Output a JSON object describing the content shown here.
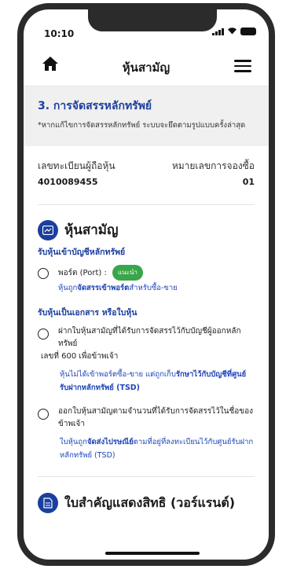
{
  "status": {
    "time": "10:10"
  },
  "header": {
    "title": "หุ้นสามัญ"
  },
  "section": {
    "title": "3. การจัดสรรหลักทรัพย์",
    "note": "*หากแก้ไขการจัดสรรหลักทรัพย์ ระบบจะยึดตามรูปแบบครั้งล่าสุด"
  },
  "ids": {
    "holder_label": "เลขทะเบียนผู้ถือหุ้น",
    "holder_value": "4010089455",
    "order_label": "หมายเลขการจองซื้อ",
    "order_value": "01"
  },
  "stock": {
    "heading": "หุ้นสามัญ",
    "sub_portfolio": "รับหุ้นเข้าบัญชีหลักทรัพย์",
    "opt_port_label": "พอร์ต (Port) :",
    "opt_port_badge": "แนะนำ",
    "opt_port_note_pre": "หุ้นถูก",
    "opt_port_note_bold": "จัดสรรเข้าพอร์ต",
    "opt_port_note_post": "สำหรับซื้อ-ขาย",
    "sub_certificate": "รับหุ้นเป็นเอกสาร หรือใบหุ้น",
    "opt_deposit_label": "ฝากใบหุ้นสามัญที่ได้รับการจัดสรรไว้กับบัญชีผู้ออกหลักทรัพย์",
    "opt_deposit_line2": "เลขที่ 600 เพื่อข้าพเจ้า",
    "opt_deposit_note_pre": "หุ้นไม่ได้เข้าพอร์ตซื้อ-ขาย แต่ถูกเก็บ",
    "opt_deposit_note_bold": "รักษาไว้กับบัญชีที่ศูนย์รับฝากหลักทรัพย์ (TSD)",
    "opt_issue_label": "ออกใบหุ้นสามัญตามจำนวนที่ได้รับการจัดสรรไว้ในชื่อของข้าพเจ้า",
    "opt_issue_note_pre": "ใบหุ้นถูก",
    "opt_issue_note_bold": "จัดส่งไปรษณีย์",
    "opt_issue_note_post": "ตามที่อยู่ที่ลงทะเบียนไว้กับศูนย์รับฝากหลักทรัพย์ (TSD)"
  },
  "warrant": {
    "heading": "ใบสำคัญแสดงสิทธิ (วอร์แรนต์)"
  },
  "colors": {
    "brand_blue": "#1c3f9e",
    "link_blue": "#2046b8",
    "badge_green": "#3aa64a"
  }
}
